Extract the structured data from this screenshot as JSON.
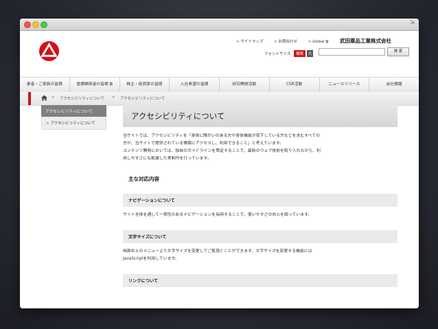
{
  "window": {
    "resize_glyph": "⇲"
  },
  "header": {
    "company_name": "武田薬品工業株式会社",
    "util_links": [
      "> サイトマップ",
      "> お問合わせ",
      "> Global ⧉"
    ],
    "font_size_label": "フォントサイズ",
    "font_size_standard": "標準",
    "font_size_large": "大",
    "search_placeholder": "",
    "search_button": "検 索",
    "logo_icon": "takeda-logo-icon",
    "accent_color": "#d3111a"
  },
  "global_nav": {
    "items": [
      "患者・ご家族の皆様",
      "医療関係者の皆様 ⧉",
      "株主・投資家の皆様",
      "入社希望の皆様",
      "研究開発活動",
      "CSR活動",
      "ニュースリリース",
      "会社情報"
    ]
  },
  "breadcrumb": {
    "home_icon": "home-icon",
    "sep": ">",
    "items": [
      "アクセシビリティについて",
      "アクセシビリティについて"
    ]
  },
  "sidebar": {
    "heading": "アクセシビリティについて",
    "items": [
      {
        "chevron": ">",
        "label": "アクセシビリティについて"
      }
    ]
  },
  "main": {
    "title": "アクセシビリティについて",
    "intro": [
      "当サイトでは、アクセシビリティを「身体に障がいのある方や身体機能が低下している方などを含むすべての",
      "方が、当サイトで提供されている情報にアクセスし、利用できること」と考えています。",
      "コンテンツ開発においては、独自のガイドラインを策定することで、最新のウェブ技術を取り入れながら、利",
      "用しやすさにも配慮した実制作を行っています。"
    ],
    "section_title": "主な対応内容",
    "subsections": [
      {
        "heading": "ナビゲーションについて",
        "lines": [
          "サイト全体を通して一貫性のあるナビゲーションを採用することで、使いやすさの向上を図っています。"
        ]
      },
      {
        "heading": "文字サイズについて",
        "lines": [
          "画面右上のメニューより文字サイズを変更してご覧頂くことができます。文字サイズを変更する機能には",
          "JavaScriptを利用しています。"
        ]
      },
      {
        "heading": "リンクについて",
        "lines": []
      }
    ]
  }
}
